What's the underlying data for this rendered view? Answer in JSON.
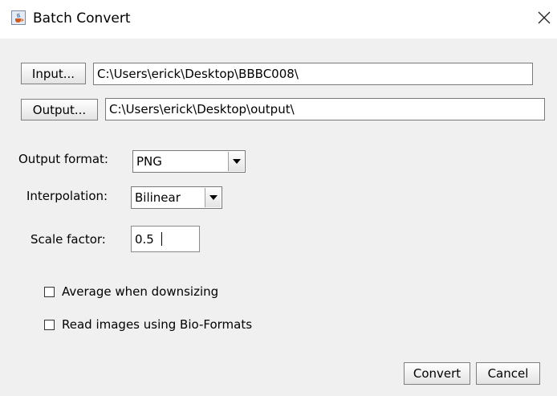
{
  "window": {
    "title": "Batch Convert",
    "icon": "java-cup-icon",
    "close_icon": "close-icon"
  },
  "input": {
    "button_label": "Input...",
    "path": "C:\\Users\\erick\\Desktop\\BBBC008\\"
  },
  "output": {
    "button_label": "Output...",
    "path": "C:\\Users\\erick\\Desktop\\output\\"
  },
  "format": {
    "label": "Output format:",
    "value": "PNG"
  },
  "interpolation": {
    "label": "Interpolation:",
    "value": "Bilinear"
  },
  "scale": {
    "label": "Scale factor:",
    "value": "0.5"
  },
  "options": {
    "average_label": "Average when downsizing",
    "average_checked": false,
    "bioformats_label": "Read images using Bio-Formats",
    "bioformats_checked": false
  },
  "actions": {
    "convert_label": "Convert",
    "cancel_label": "Cancel"
  }
}
